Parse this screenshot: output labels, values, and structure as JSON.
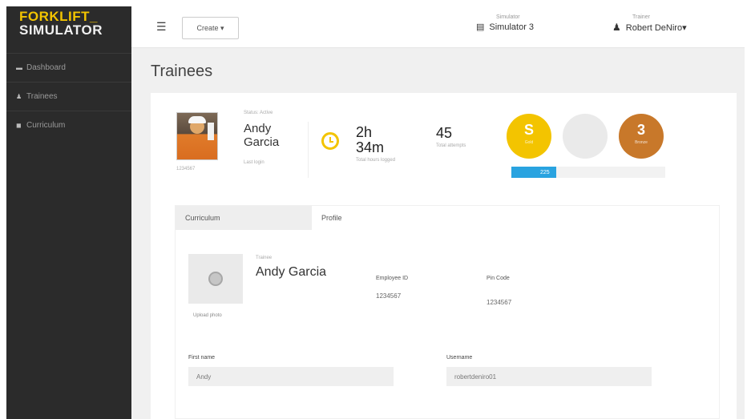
{
  "logo": {
    "line1": "FORKLIFT_",
    "line2": "SIMULATOR"
  },
  "sidebar": {
    "items": [
      {
        "label": "Dashboard",
        "icon": "dashboard-icon"
      },
      {
        "label": "Trainees",
        "icon": "user-icon"
      },
      {
        "label": "Curriculum",
        "icon": "book-icon"
      }
    ]
  },
  "topbar": {
    "create_label": "Create ▾",
    "simulator_label": "Simulator",
    "simulator_value": "Simulator 3",
    "trainer_label": "Trainer",
    "trainer_value": "Robert DeNiro▾"
  },
  "page": {
    "title": "Trainees"
  },
  "trainee": {
    "id": "1234567",
    "status": "Status: Active",
    "first_name": "Andy",
    "last_name": "Garcia",
    "last_login": "Last login",
    "hours": "2h",
    "minutes": "34m",
    "hours_label": "Total hours logged",
    "attempts": "45",
    "attempts_label": "Total attempts"
  },
  "badges": [
    {
      "big": "S",
      "small": "Gold",
      "color": "#f3c400"
    },
    {
      "big": "",
      "small": "",
      "color": "#eaeaea"
    },
    {
      "big": "3",
      "small": "Bronze",
      "color": "#c8782a"
    }
  ],
  "progress": {
    "label": "225",
    "fraction": 0.29
  },
  "tabs": [
    "Curriculum",
    "Profile"
  ],
  "profile": {
    "upload_label": "Upload photo",
    "trainee_label": "Trainee",
    "full_name": "Andy Garcia",
    "employee_id_label": "Employee ID",
    "employee_id": "1234567",
    "pin_label": "Pin Code",
    "pin": "1234567",
    "first_name_label": "First name",
    "first_name_value": "Andy",
    "username_label": "Username",
    "username_value": "robertdeniro01"
  }
}
